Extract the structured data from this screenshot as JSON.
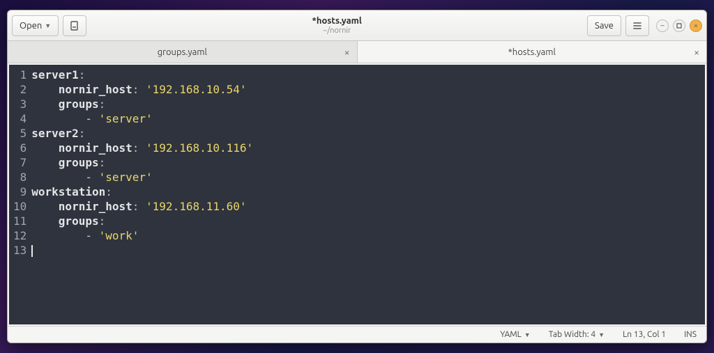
{
  "window": {
    "title": "*hosts.yaml",
    "subtitle": "~/nornir",
    "open_label": "Open",
    "save_label": "Save"
  },
  "tabs": [
    {
      "label": "groups.yaml",
      "active": false
    },
    {
      "label": "*hosts.yaml",
      "active": true
    }
  ],
  "editor": {
    "lines": [
      [
        {
          "t": "server1",
          "c": "k-key"
        },
        {
          "t": ":",
          "c": "k-colon"
        }
      ],
      [
        {
          "t": "    ",
          "c": ""
        },
        {
          "t": "nornir_host",
          "c": "k-key"
        },
        {
          "t": ": ",
          "c": "k-colon"
        },
        {
          "t": "'192.168.10.54'",
          "c": "k-str"
        }
      ],
      [
        {
          "t": "    ",
          "c": ""
        },
        {
          "t": "groups",
          "c": "k-key"
        },
        {
          "t": ":",
          "c": "k-colon"
        }
      ],
      [
        {
          "t": "        ",
          "c": ""
        },
        {
          "t": "- ",
          "c": "k-dash"
        },
        {
          "t": "'server'",
          "c": "k-str"
        }
      ],
      [
        {
          "t": "server2",
          "c": "k-key"
        },
        {
          "t": ":",
          "c": "k-colon"
        }
      ],
      [
        {
          "t": "    ",
          "c": ""
        },
        {
          "t": "nornir_host",
          "c": "k-key"
        },
        {
          "t": ": ",
          "c": "k-colon"
        },
        {
          "t": "'192.168.10.116'",
          "c": "k-str"
        }
      ],
      [
        {
          "t": "    ",
          "c": ""
        },
        {
          "t": "groups",
          "c": "k-key"
        },
        {
          "t": ":",
          "c": "k-colon"
        }
      ],
      [
        {
          "t": "        ",
          "c": ""
        },
        {
          "t": "- ",
          "c": "k-dash"
        },
        {
          "t": "'server'",
          "c": "k-str"
        }
      ],
      [
        {
          "t": "workstation",
          "c": "k-key"
        },
        {
          "t": ":",
          "c": "k-colon"
        }
      ],
      [
        {
          "t": "    ",
          "c": ""
        },
        {
          "t": "nornir_host",
          "c": "k-key"
        },
        {
          "t": ": ",
          "c": "k-colon"
        },
        {
          "t": "'192.168.11.60'",
          "c": "k-str"
        }
      ],
      [
        {
          "t": "    ",
          "c": ""
        },
        {
          "t": "groups",
          "c": "k-key"
        },
        {
          "t": ":",
          "c": "k-colon"
        }
      ],
      [
        {
          "t": "        ",
          "c": ""
        },
        {
          "t": "- ",
          "c": "k-dash"
        },
        {
          "t": "'work'",
          "c": "k-str"
        }
      ],
      []
    ]
  },
  "status": {
    "language": "YAML",
    "tab_width_label": "Tab Width: 4",
    "position": "Ln 13, Col 1",
    "insert_mode": "INS"
  }
}
